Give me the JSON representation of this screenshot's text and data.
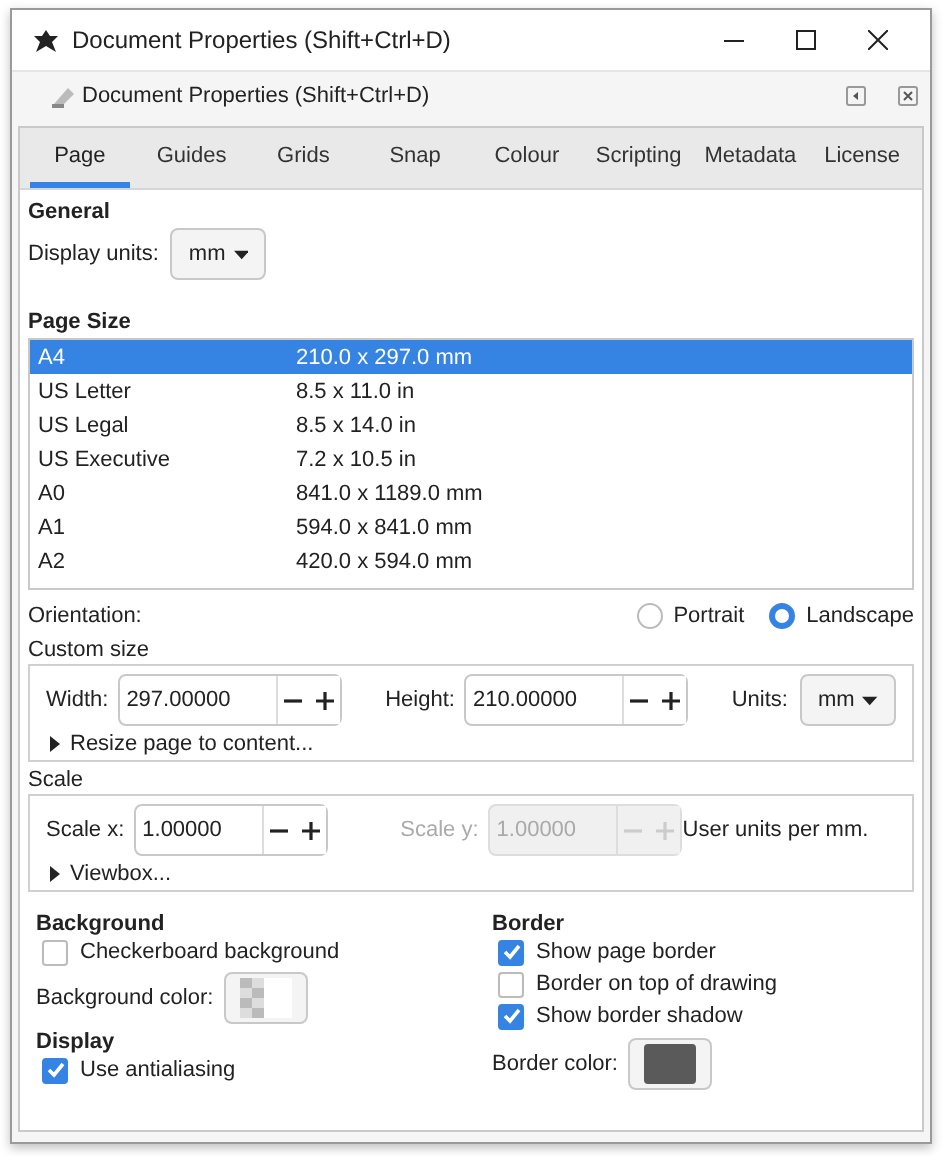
{
  "window": {
    "title": "Document Properties (Shift+Ctrl+D)"
  },
  "panel": {
    "title": "Document Properties (Shift+Ctrl+D)"
  },
  "tabs": [
    {
      "label": "Page",
      "selected": true
    },
    {
      "label": "Guides",
      "selected": false
    },
    {
      "label": "Grids",
      "selected": false
    },
    {
      "label": "Snap",
      "selected": false
    },
    {
      "label": "Colour",
      "selected": false
    },
    {
      "label": "Scripting",
      "selected": false
    },
    {
      "label": "Metadata",
      "selected": false
    },
    {
      "label": "License",
      "selected": false
    }
  ],
  "general": {
    "heading": "General",
    "display_units_label": "Display units:",
    "display_units": "mm"
  },
  "page_size": {
    "heading": "Page Size",
    "rows": [
      {
        "name": "A4",
        "size": "210.0 x 297.0 mm",
        "selected": true
      },
      {
        "name": "US Letter",
        "size": "8.5 x 11.0 in",
        "selected": false
      },
      {
        "name": "US Legal",
        "size": "8.5 x 14.0 in",
        "selected": false
      },
      {
        "name": "US Executive",
        "size": "7.2 x 10.5 in",
        "selected": false
      },
      {
        "name": "A0",
        "size": "841.0 x 1189.0 mm",
        "selected": false
      },
      {
        "name": "A1",
        "size": "594.0 x 841.0 mm",
        "selected": false
      },
      {
        "name": "A2",
        "size": "420.0 x 594.0 mm",
        "selected": false
      }
    ]
  },
  "orientation": {
    "label": "Orientation:",
    "options": [
      {
        "label": "Portrait",
        "selected": false
      },
      {
        "label": "Landscape",
        "selected": true
      }
    ]
  },
  "custom_size": {
    "heading": "Custom size",
    "fields": [
      {
        "label": "Width:",
        "value": "297.00000",
        "disabled": false
      },
      {
        "label": "Height:",
        "value": "210.00000",
        "disabled": false
      }
    ],
    "units_label": "Units:",
    "units": "mm",
    "expander": {
      "label": "Resize page to content...",
      "expanded": false
    }
  },
  "scale": {
    "heading": "Scale",
    "fields": [
      {
        "label": "Scale x:",
        "value": "1.00000",
        "disabled": false
      },
      {
        "label": "Scale y:",
        "value": "1.00000",
        "disabled": true
      }
    ],
    "note": "User units per mm.",
    "expander": {
      "label": "Viewbox...",
      "expanded": false
    }
  },
  "background": {
    "heading": "Background",
    "checks": [
      {
        "label": "Checkerboard background",
        "checked": false
      }
    ],
    "color_label": "Background color:"
  },
  "display": {
    "heading": "Display",
    "checks": [
      {
        "label": "Use antialiasing",
        "checked": true
      }
    ]
  },
  "border": {
    "heading": "Border",
    "checks": [
      {
        "label": "Show page border",
        "checked": true
      },
      {
        "label": "Border on top of drawing",
        "checked": false
      },
      {
        "label": "Show border shadow",
        "checked": true
      }
    ],
    "color_label": "Border color:"
  }
}
